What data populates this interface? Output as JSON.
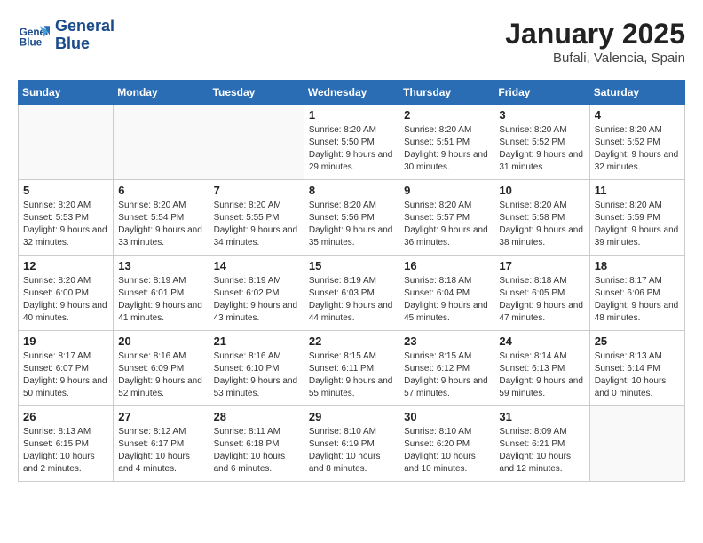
{
  "header": {
    "logo_line1": "General",
    "logo_line2": "Blue",
    "month_title": "January 2025",
    "location": "Bufali, Valencia, Spain"
  },
  "days_of_week": [
    "Sunday",
    "Monday",
    "Tuesday",
    "Wednesday",
    "Thursday",
    "Friday",
    "Saturday"
  ],
  "weeks": [
    [
      {
        "day": "",
        "info": ""
      },
      {
        "day": "",
        "info": ""
      },
      {
        "day": "",
        "info": ""
      },
      {
        "day": "1",
        "info": "Sunrise: 8:20 AM\nSunset: 5:50 PM\nDaylight: 9 hours\nand 29 minutes."
      },
      {
        "day": "2",
        "info": "Sunrise: 8:20 AM\nSunset: 5:51 PM\nDaylight: 9 hours\nand 30 minutes."
      },
      {
        "day": "3",
        "info": "Sunrise: 8:20 AM\nSunset: 5:52 PM\nDaylight: 9 hours\nand 31 minutes."
      },
      {
        "day": "4",
        "info": "Sunrise: 8:20 AM\nSunset: 5:52 PM\nDaylight: 9 hours\nand 32 minutes."
      }
    ],
    [
      {
        "day": "5",
        "info": "Sunrise: 8:20 AM\nSunset: 5:53 PM\nDaylight: 9 hours\nand 32 minutes."
      },
      {
        "day": "6",
        "info": "Sunrise: 8:20 AM\nSunset: 5:54 PM\nDaylight: 9 hours\nand 33 minutes."
      },
      {
        "day": "7",
        "info": "Sunrise: 8:20 AM\nSunset: 5:55 PM\nDaylight: 9 hours\nand 34 minutes."
      },
      {
        "day": "8",
        "info": "Sunrise: 8:20 AM\nSunset: 5:56 PM\nDaylight: 9 hours\nand 35 minutes."
      },
      {
        "day": "9",
        "info": "Sunrise: 8:20 AM\nSunset: 5:57 PM\nDaylight: 9 hours\nand 36 minutes."
      },
      {
        "day": "10",
        "info": "Sunrise: 8:20 AM\nSunset: 5:58 PM\nDaylight: 9 hours\nand 38 minutes."
      },
      {
        "day": "11",
        "info": "Sunrise: 8:20 AM\nSunset: 5:59 PM\nDaylight: 9 hours\nand 39 minutes."
      }
    ],
    [
      {
        "day": "12",
        "info": "Sunrise: 8:20 AM\nSunset: 6:00 PM\nDaylight: 9 hours\nand 40 minutes."
      },
      {
        "day": "13",
        "info": "Sunrise: 8:19 AM\nSunset: 6:01 PM\nDaylight: 9 hours\nand 41 minutes."
      },
      {
        "day": "14",
        "info": "Sunrise: 8:19 AM\nSunset: 6:02 PM\nDaylight: 9 hours\nand 43 minutes."
      },
      {
        "day": "15",
        "info": "Sunrise: 8:19 AM\nSunset: 6:03 PM\nDaylight: 9 hours\nand 44 minutes."
      },
      {
        "day": "16",
        "info": "Sunrise: 8:18 AM\nSunset: 6:04 PM\nDaylight: 9 hours\nand 45 minutes."
      },
      {
        "day": "17",
        "info": "Sunrise: 8:18 AM\nSunset: 6:05 PM\nDaylight: 9 hours\nand 47 minutes."
      },
      {
        "day": "18",
        "info": "Sunrise: 8:17 AM\nSunset: 6:06 PM\nDaylight: 9 hours\nand 48 minutes."
      }
    ],
    [
      {
        "day": "19",
        "info": "Sunrise: 8:17 AM\nSunset: 6:07 PM\nDaylight: 9 hours\nand 50 minutes."
      },
      {
        "day": "20",
        "info": "Sunrise: 8:16 AM\nSunset: 6:09 PM\nDaylight: 9 hours\nand 52 minutes."
      },
      {
        "day": "21",
        "info": "Sunrise: 8:16 AM\nSunset: 6:10 PM\nDaylight: 9 hours\nand 53 minutes."
      },
      {
        "day": "22",
        "info": "Sunrise: 8:15 AM\nSunset: 6:11 PM\nDaylight: 9 hours\nand 55 minutes."
      },
      {
        "day": "23",
        "info": "Sunrise: 8:15 AM\nSunset: 6:12 PM\nDaylight: 9 hours\nand 57 minutes."
      },
      {
        "day": "24",
        "info": "Sunrise: 8:14 AM\nSunset: 6:13 PM\nDaylight: 9 hours\nand 59 minutes."
      },
      {
        "day": "25",
        "info": "Sunrise: 8:13 AM\nSunset: 6:14 PM\nDaylight: 10 hours\nand 0 minutes."
      }
    ],
    [
      {
        "day": "26",
        "info": "Sunrise: 8:13 AM\nSunset: 6:15 PM\nDaylight: 10 hours\nand 2 minutes."
      },
      {
        "day": "27",
        "info": "Sunrise: 8:12 AM\nSunset: 6:17 PM\nDaylight: 10 hours\nand 4 minutes."
      },
      {
        "day": "28",
        "info": "Sunrise: 8:11 AM\nSunset: 6:18 PM\nDaylight: 10 hours\nand 6 minutes."
      },
      {
        "day": "29",
        "info": "Sunrise: 8:10 AM\nSunset: 6:19 PM\nDaylight: 10 hours\nand 8 minutes."
      },
      {
        "day": "30",
        "info": "Sunrise: 8:10 AM\nSunset: 6:20 PM\nDaylight: 10 hours\nand 10 minutes."
      },
      {
        "day": "31",
        "info": "Sunrise: 8:09 AM\nSunset: 6:21 PM\nDaylight: 10 hours\nand 12 minutes."
      },
      {
        "day": "",
        "info": ""
      }
    ]
  ]
}
